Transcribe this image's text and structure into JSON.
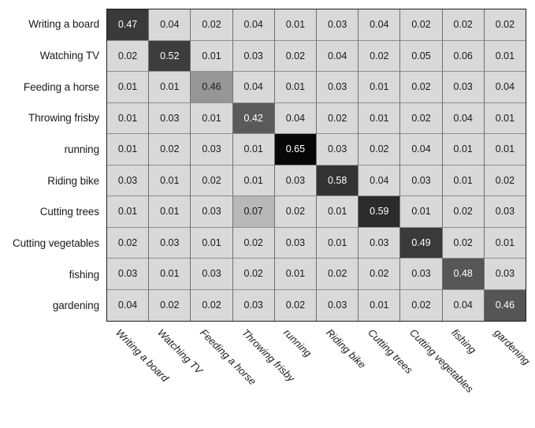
{
  "figure": {
    "kind": "confusion-matrix",
    "background_color": "#ffffff",
    "grid_border_color": "#1d1d1d"
  },
  "chart_data": {
    "type": "heatmap",
    "title": "",
    "xlabel": "",
    "ylabel": "",
    "grid": true,
    "legend": "none",
    "value_format": "0.00",
    "colorscale": {
      "low": "#d9d9d9",
      "high": "#000000",
      "note": "cell darkness increases with value; diagonal values are darkest"
    },
    "categories": [
      "Writing a board",
      "Watching TV",
      "Feeding a horse",
      "Throwing frisby",
      "running",
      "Riding bike",
      "Cutting trees",
      "Cutting vegetables",
      "fishing",
      "gardening"
    ],
    "row_labels": [
      "Writing a board",
      "Watching TV",
      "Feeding a horse",
      "Throwing frisby",
      "running",
      "Riding bike",
      "Cutting trees",
      "Cutting vegetables",
      "fishing",
      "gardening"
    ],
    "column_labels": [
      "Writing a board",
      "Watching TV",
      "Feeding a horse",
      "Throwing frisby",
      "running",
      "Riding bike",
      "Cutting trees",
      "Cutting vegetables",
      "fishing",
      "gardening"
    ],
    "values": [
      [
        "0.47",
        "0.04",
        "0.02",
        "0.04",
        "0.01",
        "0.03",
        "0.04",
        "0.02",
        "0.02",
        "0.02"
      ],
      [
        "0.02",
        "0.52",
        "0.01",
        "0.03",
        "0.02",
        "0.04",
        "0.02",
        "0.05",
        "0.06",
        "0.01"
      ],
      [
        "0.01",
        "0.01",
        "0.46",
        "0.04",
        "0.01",
        "0.03",
        "0.01",
        "0.02",
        "0.03",
        "0.04"
      ],
      [
        "0.01",
        "0.03",
        "0.01",
        "0.42",
        "0.04",
        "0.02",
        "0.01",
        "0.02",
        "0.04",
        "0.01"
      ],
      [
        "0.01",
        "0.02",
        "0.03",
        "0.01",
        "0.65",
        "0.03",
        "0.02",
        "0.04",
        "0.01",
        "0.01"
      ],
      [
        "0.03",
        "0.01",
        "0.02",
        "0.01",
        "0.03",
        "0.58",
        "0.04",
        "0.03",
        "0.01",
        "0.02"
      ],
      [
        "0.01",
        "0.01",
        "0.03",
        "0.07",
        "0.02",
        "0.01",
        "0.59",
        "0.01",
        "0.02",
        "0.03"
      ],
      [
        "0.02",
        "0.03",
        "0.01",
        "0.02",
        "0.03",
        "0.01",
        "0.03",
        "0.49",
        "0.02",
        "0.01"
      ],
      [
        "0.03",
        "0.01",
        "0.03",
        "0.02",
        "0.01",
        "0.02",
        "0.02",
        "0.03",
        "0.48",
        "0.03"
      ],
      [
        "0.04",
        "0.02",
        "0.02",
        "0.03",
        "0.02",
        "0.03",
        "0.01",
        "0.02",
        "0.04",
        "0.46"
      ]
    ],
    "cell_styles": [
      [
        {
          "bg": "#3a3a3a",
          "fg": "#ffffff"
        },
        {
          "bg": "#d9d9d9",
          "fg": "#1a1a1a"
        },
        {
          "bg": "#d9d9d9",
          "fg": "#1a1a1a"
        },
        {
          "bg": "#d9d9d9",
          "fg": "#1a1a1a"
        },
        {
          "bg": "#d9d9d9",
          "fg": "#1a1a1a"
        },
        {
          "bg": "#d9d9d9",
          "fg": "#1a1a1a"
        },
        {
          "bg": "#d9d9d9",
          "fg": "#1a1a1a"
        },
        {
          "bg": "#d9d9d9",
          "fg": "#1a1a1a"
        },
        {
          "bg": "#d9d9d9",
          "fg": "#1a1a1a"
        },
        {
          "bg": "#d9d9d9",
          "fg": "#1a1a1a"
        }
      ],
      [
        {
          "bg": "#d9d9d9",
          "fg": "#1a1a1a"
        },
        {
          "bg": "#3d3d3d",
          "fg": "#ffffff"
        },
        {
          "bg": "#d9d9d9",
          "fg": "#1a1a1a"
        },
        {
          "bg": "#d9d9d9",
          "fg": "#1a1a1a"
        },
        {
          "bg": "#d9d9d9",
          "fg": "#1a1a1a"
        },
        {
          "bg": "#d9d9d9",
          "fg": "#1a1a1a"
        },
        {
          "bg": "#d9d9d9",
          "fg": "#1a1a1a"
        },
        {
          "bg": "#d9d9d9",
          "fg": "#1a1a1a"
        },
        {
          "bg": "#d9d9d9",
          "fg": "#1a1a1a"
        },
        {
          "bg": "#d9d9d9",
          "fg": "#1a1a1a"
        }
      ],
      [
        {
          "bg": "#d9d9d9",
          "fg": "#1a1a1a"
        },
        {
          "bg": "#d9d9d9",
          "fg": "#1a1a1a"
        },
        {
          "bg": "#969696",
          "fg": "#1a1a1a"
        },
        {
          "bg": "#d9d9d9",
          "fg": "#1a1a1a"
        },
        {
          "bg": "#d9d9d9",
          "fg": "#1a1a1a"
        },
        {
          "bg": "#d9d9d9",
          "fg": "#1a1a1a"
        },
        {
          "bg": "#d9d9d9",
          "fg": "#1a1a1a"
        },
        {
          "bg": "#d9d9d9",
          "fg": "#1a1a1a"
        },
        {
          "bg": "#d9d9d9",
          "fg": "#1a1a1a"
        },
        {
          "bg": "#d9d9d9",
          "fg": "#1a1a1a"
        }
      ],
      [
        {
          "bg": "#d9d9d9",
          "fg": "#1a1a1a"
        },
        {
          "bg": "#d9d9d9",
          "fg": "#1a1a1a"
        },
        {
          "bg": "#d9d9d9",
          "fg": "#1a1a1a"
        },
        {
          "bg": "#5a5a5a",
          "fg": "#ffffff"
        },
        {
          "bg": "#d9d9d9",
          "fg": "#1a1a1a"
        },
        {
          "bg": "#d9d9d9",
          "fg": "#1a1a1a"
        },
        {
          "bg": "#d9d9d9",
          "fg": "#1a1a1a"
        },
        {
          "bg": "#d9d9d9",
          "fg": "#1a1a1a"
        },
        {
          "bg": "#d9d9d9",
          "fg": "#1a1a1a"
        },
        {
          "bg": "#d9d9d9",
          "fg": "#1a1a1a"
        }
      ],
      [
        {
          "bg": "#d9d9d9",
          "fg": "#1a1a1a"
        },
        {
          "bg": "#d9d9d9",
          "fg": "#1a1a1a"
        },
        {
          "bg": "#d9d9d9",
          "fg": "#1a1a1a"
        },
        {
          "bg": "#d9d9d9",
          "fg": "#1a1a1a"
        },
        {
          "bg": "#070707",
          "fg": "#ffffff"
        },
        {
          "bg": "#d9d9d9",
          "fg": "#1a1a1a"
        },
        {
          "bg": "#d9d9d9",
          "fg": "#1a1a1a"
        },
        {
          "bg": "#d9d9d9",
          "fg": "#1a1a1a"
        },
        {
          "bg": "#d9d9d9",
          "fg": "#1a1a1a"
        },
        {
          "bg": "#d9d9d9",
          "fg": "#1a1a1a"
        }
      ],
      [
        {
          "bg": "#d9d9d9",
          "fg": "#1a1a1a"
        },
        {
          "bg": "#d9d9d9",
          "fg": "#1a1a1a"
        },
        {
          "bg": "#d9d9d9",
          "fg": "#1a1a1a"
        },
        {
          "bg": "#d9d9d9",
          "fg": "#1a1a1a"
        },
        {
          "bg": "#d9d9d9",
          "fg": "#1a1a1a"
        },
        {
          "bg": "#333333",
          "fg": "#ffffff"
        },
        {
          "bg": "#d9d9d9",
          "fg": "#1a1a1a"
        },
        {
          "bg": "#d9d9d9",
          "fg": "#1a1a1a"
        },
        {
          "bg": "#d9d9d9",
          "fg": "#1a1a1a"
        },
        {
          "bg": "#d9d9d9",
          "fg": "#1a1a1a"
        }
      ],
      [
        {
          "bg": "#d9d9d9",
          "fg": "#1a1a1a"
        },
        {
          "bg": "#d9d9d9",
          "fg": "#1a1a1a"
        },
        {
          "bg": "#d9d9d9",
          "fg": "#1a1a1a"
        },
        {
          "bg": "#b8b8b8",
          "fg": "#1a1a1a"
        },
        {
          "bg": "#d9d9d9",
          "fg": "#1a1a1a"
        },
        {
          "bg": "#d9d9d9",
          "fg": "#1a1a1a"
        },
        {
          "bg": "#2b2b2b",
          "fg": "#ffffff"
        },
        {
          "bg": "#d9d9d9",
          "fg": "#1a1a1a"
        },
        {
          "bg": "#d9d9d9",
          "fg": "#1a1a1a"
        },
        {
          "bg": "#d9d9d9",
          "fg": "#1a1a1a"
        }
      ],
      [
        {
          "bg": "#d9d9d9",
          "fg": "#1a1a1a"
        },
        {
          "bg": "#d9d9d9",
          "fg": "#1a1a1a"
        },
        {
          "bg": "#d9d9d9",
          "fg": "#1a1a1a"
        },
        {
          "bg": "#d9d9d9",
          "fg": "#1a1a1a"
        },
        {
          "bg": "#d9d9d9",
          "fg": "#1a1a1a"
        },
        {
          "bg": "#d9d9d9",
          "fg": "#1a1a1a"
        },
        {
          "bg": "#d9d9d9",
          "fg": "#1a1a1a"
        },
        {
          "bg": "#3a3a3a",
          "fg": "#ffffff"
        },
        {
          "bg": "#d9d9d9",
          "fg": "#1a1a1a"
        },
        {
          "bg": "#d9d9d9",
          "fg": "#1a1a1a"
        }
      ],
      [
        {
          "bg": "#d9d9d9",
          "fg": "#1a1a1a"
        },
        {
          "bg": "#d9d9d9",
          "fg": "#1a1a1a"
        },
        {
          "bg": "#d9d9d9",
          "fg": "#1a1a1a"
        },
        {
          "bg": "#d9d9d9",
          "fg": "#1a1a1a"
        },
        {
          "bg": "#d9d9d9",
          "fg": "#1a1a1a"
        },
        {
          "bg": "#d9d9d9",
          "fg": "#1a1a1a"
        },
        {
          "bg": "#d9d9d9",
          "fg": "#1a1a1a"
        },
        {
          "bg": "#d9d9d9",
          "fg": "#1a1a1a"
        },
        {
          "bg": "#565656",
          "fg": "#ffffff"
        },
        {
          "bg": "#d9d9d9",
          "fg": "#1a1a1a"
        }
      ],
      [
        {
          "bg": "#d9d9d9",
          "fg": "#1a1a1a"
        },
        {
          "bg": "#d9d9d9",
          "fg": "#1a1a1a"
        },
        {
          "bg": "#d9d9d9",
          "fg": "#1a1a1a"
        },
        {
          "bg": "#d9d9d9",
          "fg": "#1a1a1a"
        },
        {
          "bg": "#d9d9d9",
          "fg": "#1a1a1a"
        },
        {
          "bg": "#d9d9d9",
          "fg": "#1a1a1a"
        },
        {
          "bg": "#d9d9d9",
          "fg": "#1a1a1a"
        },
        {
          "bg": "#d9d9d9",
          "fg": "#1a1a1a"
        },
        {
          "bg": "#d9d9d9",
          "fg": "#1a1a1a"
        },
        {
          "bg": "#555555",
          "fg": "#ffffff"
        }
      ]
    ]
  }
}
